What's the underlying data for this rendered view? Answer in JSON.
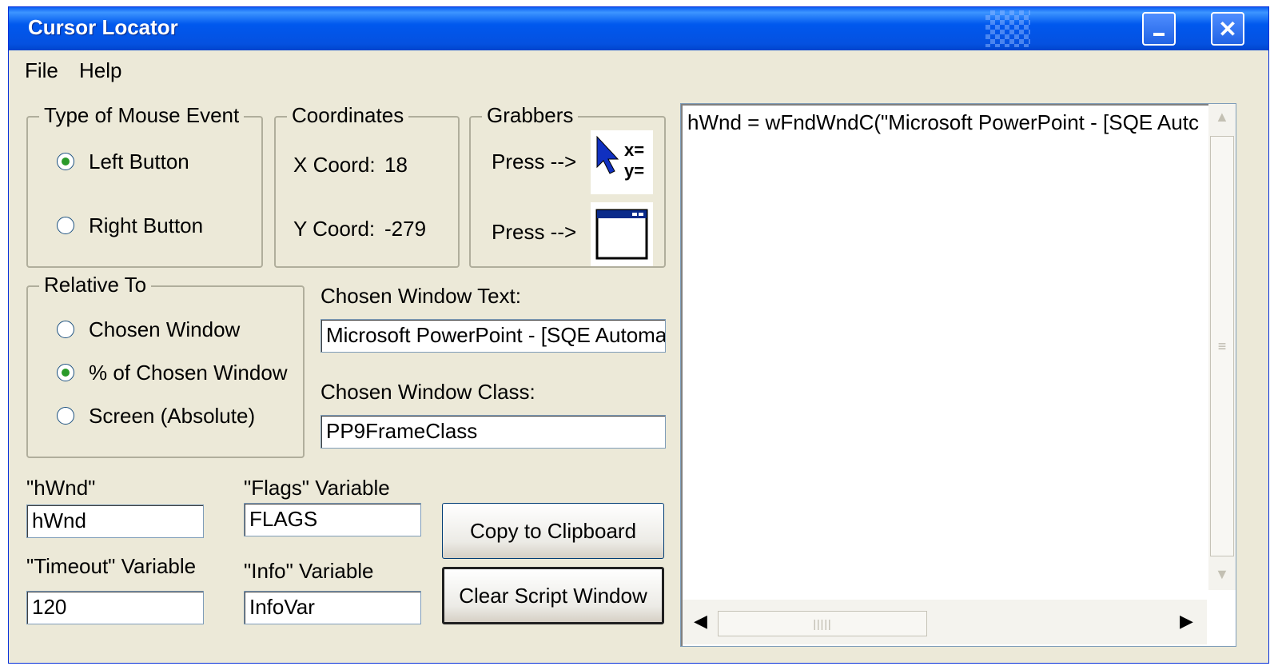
{
  "window": {
    "title": "Cursor Locator"
  },
  "menu": {
    "items": [
      "File",
      "Help"
    ]
  },
  "mouse_event": {
    "legend": "Type of Mouse Event",
    "options": [
      "Left Button",
      "Right Button"
    ],
    "selected": "Left Button"
  },
  "coordinates": {
    "legend": "Coordinates",
    "x_label": "X Coord:",
    "x_value": "18",
    "y_label": "Y Coord:",
    "y_value": "-279"
  },
  "grabbers": {
    "legend": "Grabbers",
    "press1": "Press -->",
    "press2": "Press -->",
    "xy_glyph_x": "x=",
    "xy_glyph_y": "y="
  },
  "relative_to": {
    "legend": "Relative To",
    "options": [
      "Chosen Window",
      "% of Chosen Window",
      "Screen (Absolute)"
    ],
    "selected": "% of Chosen Window"
  },
  "chosen_window": {
    "text_label": "Chosen Window Text:",
    "text_value": "Microsoft PowerPoint - [SQE Automa",
    "class_label": "Chosen Window Class:",
    "class_value": "PP9FrameClass"
  },
  "vars": {
    "hwnd_label": "\"hWnd\"",
    "hwnd_value": "hWnd",
    "flags_label": "\"Flags\" Variable",
    "flags_value": "FLAGS",
    "timeout_label": "\"Timeout\" Variable",
    "timeout_value": "120",
    "info_label": "\"Info\" Variable",
    "info_value": "InfoVar"
  },
  "buttons": {
    "copy": "Copy to Clipboard",
    "clear": "Clear Script Window"
  },
  "script": {
    "line": "hWnd = wFndWndC(\"Microsoft PowerPoint - [SQE Autc"
  }
}
